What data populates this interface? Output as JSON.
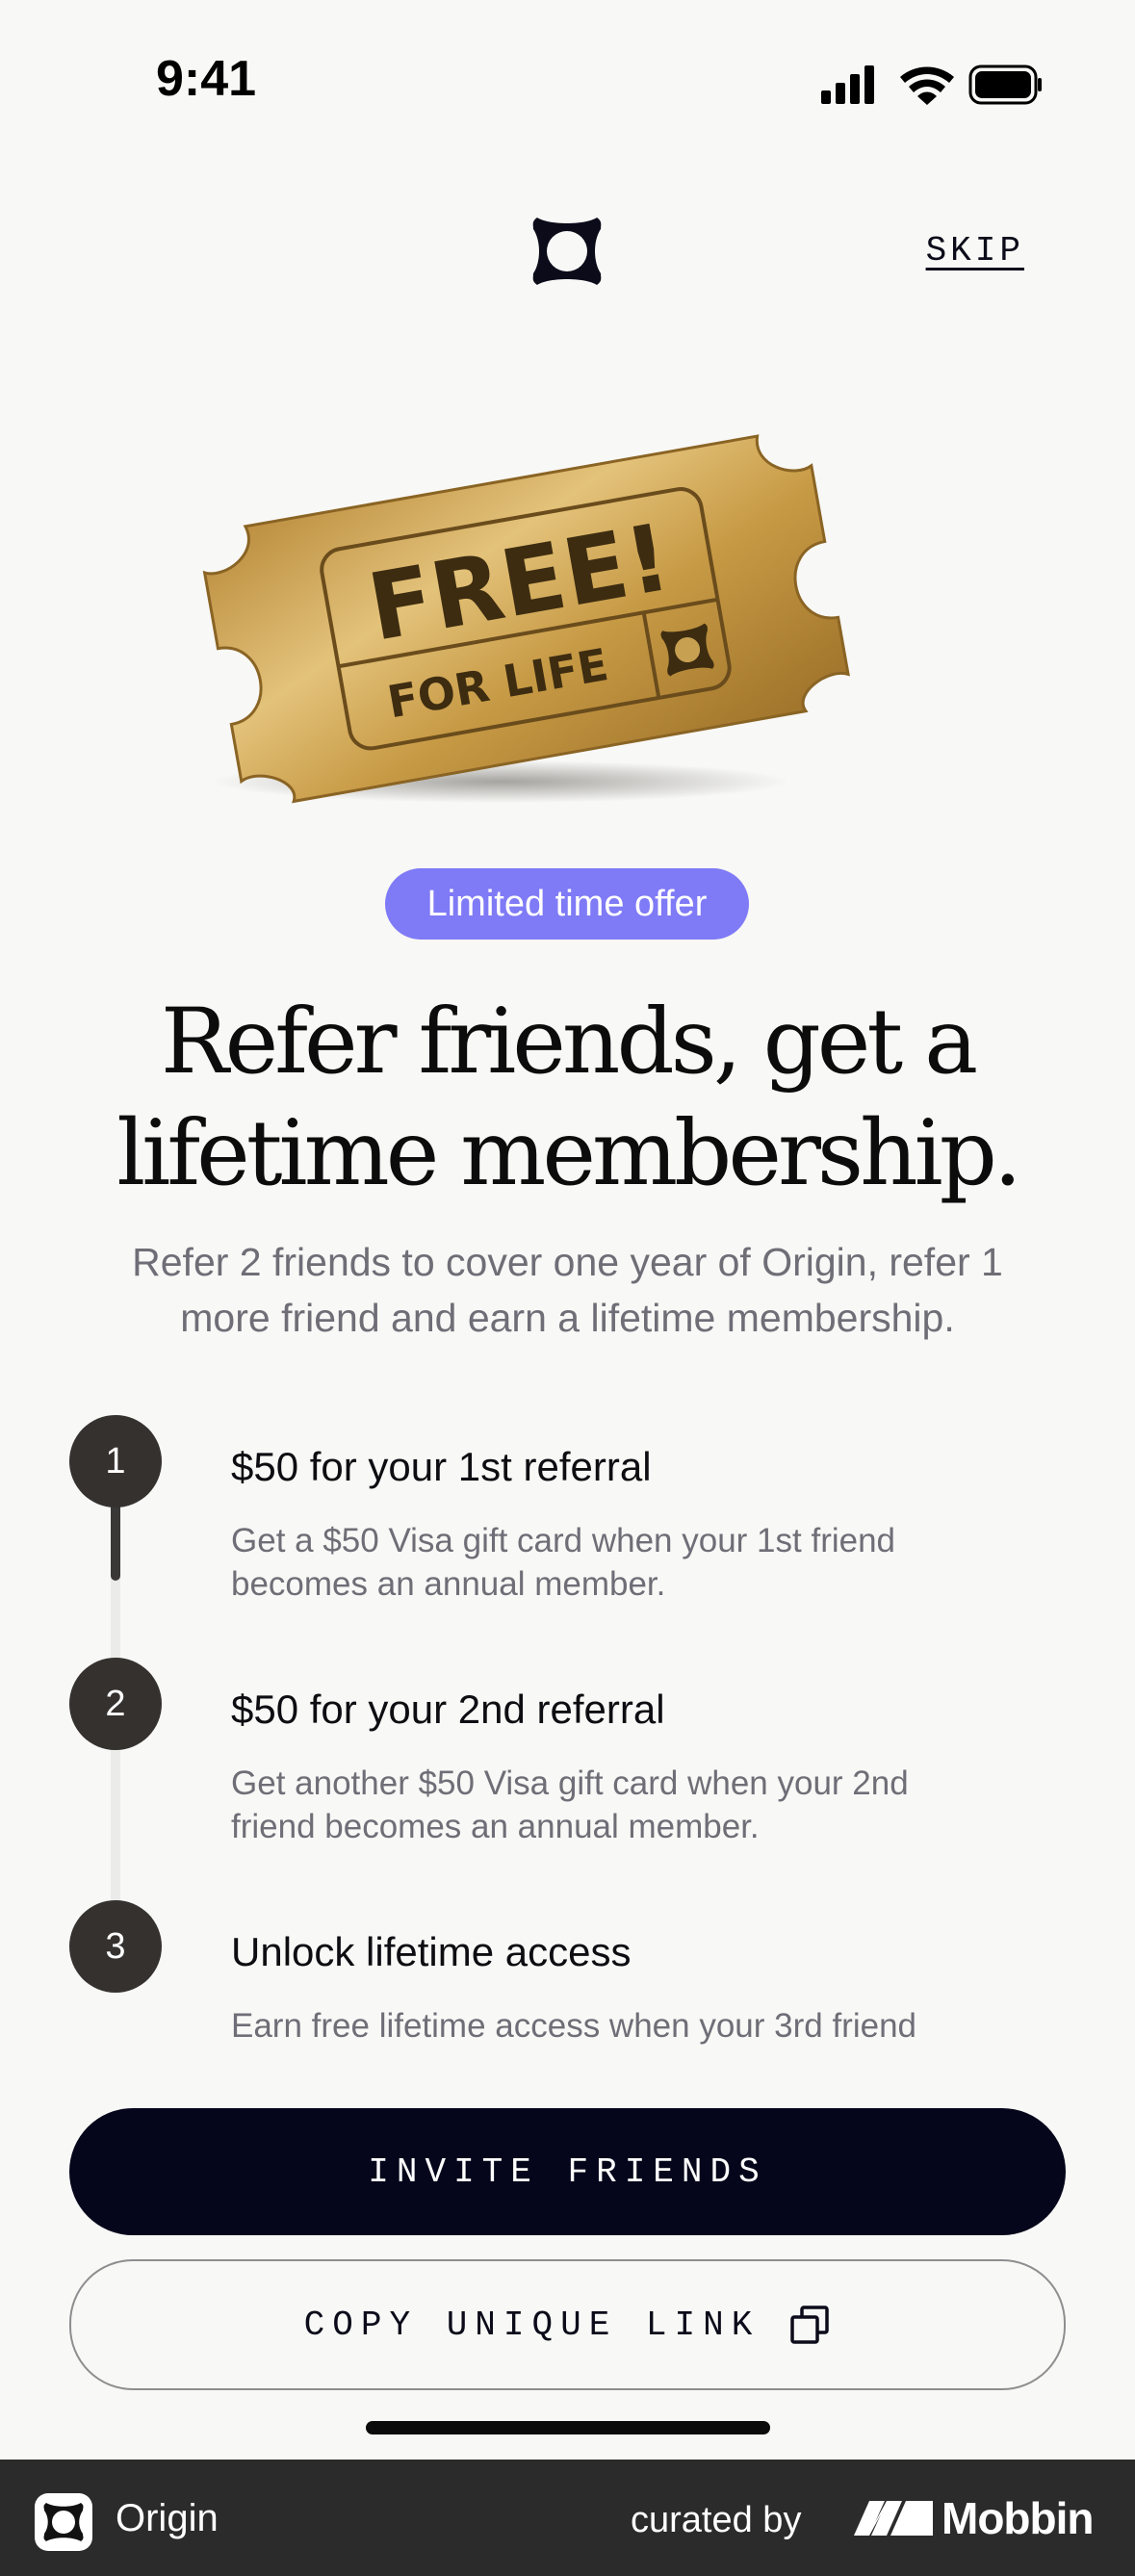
{
  "status_bar": {
    "time": "9:41",
    "icons": [
      "signal-icon",
      "wifi-icon",
      "battery-icon"
    ]
  },
  "header": {
    "logo_icon": "origin-logo-icon",
    "skip_label": "SKIP"
  },
  "hero": {
    "ticket_line1": "FREE!",
    "ticket_line2": "FOR LIFE",
    "badge": "Limited time offer",
    "title_line1": "Refer friends, get a",
    "title_line2": "lifetime membership.",
    "subtitle_line1": "Refer 2 friends to cover one year of Origin, refer 1",
    "subtitle_line2": "more friend and earn a lifetime membership."
  },
  "steps": [
    {
      "number": "1",
      "title": "$50 for your 1st referral",
      "desc_line1": "Get a $50 Visa gift card when your 1st friend",
      "desc_line2": "becomes an annual member."
    },
    {
      "number": "2",
      "title": "$50 for your 2nd referral",
      "desc_line1": "Get another $50 Visa gift card when your 2nd",
      "desc_line2": "friend becomes an annual member."
    },
    {
      "number": "3",
      "title": "Unlock lifetime access",
      "desc_line1": "Earn free lifetime access when your 3rd friend"
    }
  ],
  "actions": {
    "invite_label": "INVITE FRIENDS",
    "copy_label": "COPY UNIQUE LINK",
    "copy_icon": "copy-icon"
  },
  "footer": {
    "app_name": "Origin",
    "curated_by": "curated by",
    "brand": "Mobbin"
  },
  "colors": {
    "background": "#f8f8f6",
    "badge": "#7f7af6",
    "primary_button": "#05061b",
    "step_circle": "#34312f",
    "muted_text": "#6f6e77",
    "ticket_gold": "#c9a04a",
    "footer": "#2b2b2b"
  }
}
